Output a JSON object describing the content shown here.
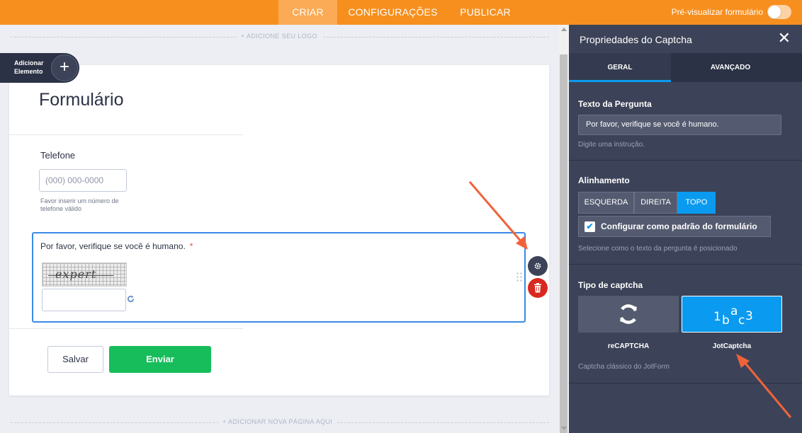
{
  "topbar": {
    "tabs": [
      {
        "label": "CRIAR",
        "active": true
      },
      {
        "label": "CONFIGURAÇÕES",
        "active": false
      },
      {
        "label": "PUBLICAR",
        "active": false
      }
    ],
    "preview_label": "Pré-visualizar formulário",
    "preview_enabled": false
  },
  "canvas": {
    "add_logo": "+ ADICIONE SEU LOGO",
    "add_page": "+ ADICIONAR NOVA PÁGINA AQUI",
    "add_element_label_1": "Adicionar",
    "add_element_label_2": "Elemento"
  },
  "form": {
    "title": "Formulário",
    "phone": {
      "label": "Telefone",
      "placeholder": "(000) 000-0000",
      "help": "Favor inserir um número de telefone válido"
    },
    "captcha": {
      "question": "Por favor, verifique se você é humano.",
      "required_mark": "*",
      "captcha_word": "expert"
    },
    "save_label": "Salvar",
    "send_label": "Enviar"
  },
  "panel": {
    "title": "Propriedades do Captcha",
    "tabs": [
      {
        "label": "GERAL",
        "active": true
      },
      {
        "label": "AVANÇADO",
        "active": false
      }
    ],
    "question_text": {
      "label": "Texto da Pergunta",
      "value": "Por favor, verifique se você é humano.",
      "help": "Digite uma instrução."
    },
    "alignment": {
      "label": "Alinhamento",
      "options": [
        {
          "label": "ESQUERDA",
          "active": false
        },
        {
          "label": "DIREITA",
          "active": false
        },
        {
          "label": "TOPO",
          "active": true
        }
      ],
      "default_checkbox_label": "Configurar como padrão do formulário",
      "default_checked": true,
      "help": "Selecione como o texto da pergunta é posicionado"
    },
    "captcha_type": {
      "label": "Tipo de captcha",
      "options": [
        {
          "label": "reCAPTCHA",
          "selected": false
        },
        {
          "label": "JotCaptcha",
          "selected": true
        }
      ],
      "jot_preview": "1bac3",
      "help": "Captcha clássico do JotForm"
    }
  },
  "colors": {
    "topbar": "#f78f1e",
    "accent_blue": "#0a9af0",
    "panel_bg": "#3c4358",
    "send_green": "#18bd5b",
    "delete_red": "#d9281f",
    "annotation_arrow": "#f0633a"
  }
}
